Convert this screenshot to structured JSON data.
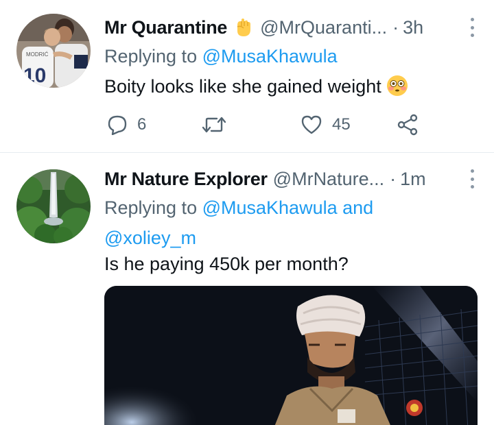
{
  "tweets": [
    {
      "name": "Mr Quarantine",
      "badge": "raised-fist-emoji",
      "handle": "@MrQuaranti...",
      "separator": "·",
      "time": "3h",
      "replying_prefix": "Replying to ",
      "replying_to": "@MusaKhawula",
      "text": "Boity looks like she gained weight",
      "text_emoji": "flushed-face-emoji",
      "counts": {
        "replies": "6",
        "retweets": "",
        "likes": "45"
      }
    },
    {
      "name": "Mr Nature Explorer",
      "handle": "@MrNature...",
      "separator": "·",
      "time": "1m",
      "replying_prefix": "Replying to ",
      "replying_to_1": "@MusaKhawula",
      "replying_join": " and",
      "replying_to_2": "@xoliey_m",
      "text": "Is he paying 450k per month?"
    }
  ],
  "colors": {
    "link": "#1d9bf0",
    "secondary_text": "#536471",
    "divider": "#e6ecf0"
  }
}
